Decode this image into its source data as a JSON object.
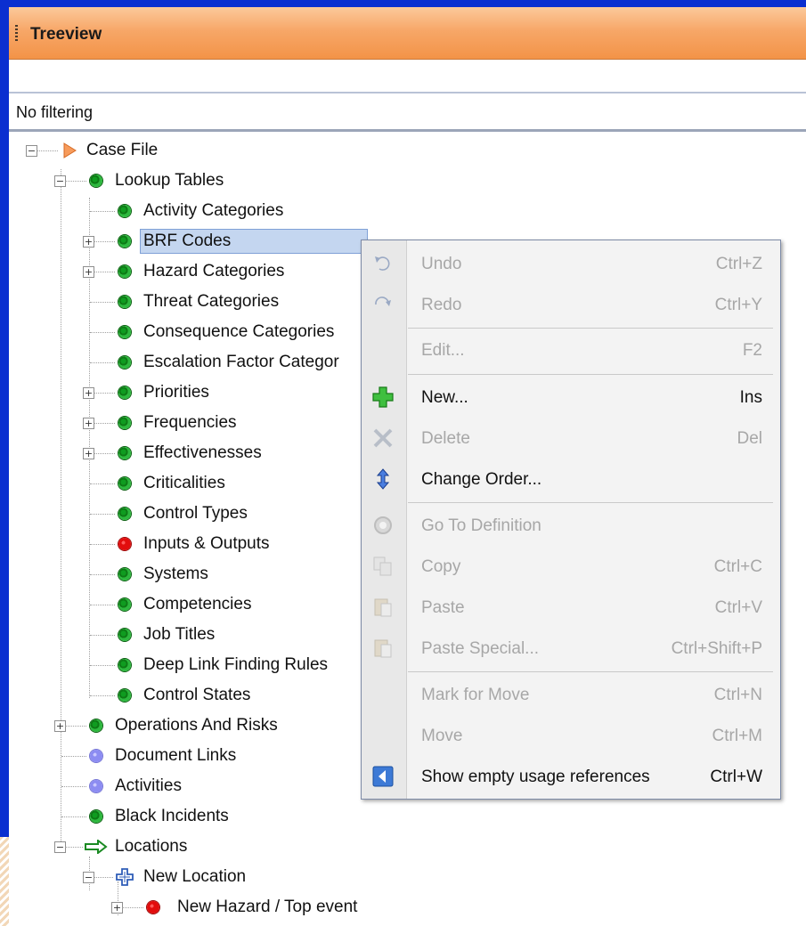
{
  "window": {
    "title": "Treeview"
  },
  "filter": {
    "label": "No filtering"
  },
  "tree": {
    "case_file": "Case File",
    "lookup_tables": "Lookup Tables",
    "items": [
      "Activity Categories",
      "BRF Codes",
      "Hazard Categories",
      "Threat Categories",
      "Consequence Categories",
      "Escalation Factor Categor",
      "Priorities",
      "Frequencies",
      "Effectivenesses",
      "Criticalities",
      "Control Types",
      "Inputs & Outputs",
      "Systems",
      "Competencies",
      "Job Titles",
      "Deep Link Finding Rules",
      "Control States"
    ],
    "operations": "Operations And Risks",
    "document_links": "Document Links",
    "activities": "Activities",
    "black_incidents": "Black Incidents",
    "locations": "Locations",
    "new_location": "New Location",
    "new_hazard": "New Hazard / Top event"
  },
  "menu": {
    "undo": {
      "label": "Undo",
      "shortcut": "Ctrl+Z"
    },
    "redo": {
      "label": "Redo",
      "shortcut": "Ctrl+Y"
    },
    "edit": {
      "label": "Edit...",
      "shortcut": "F2"
    },
    "new": {
      "label": "New...",
      "shortcut": "Ins"
    },
    "delete": {
      "label": "Delete",
      "shortcut": "Del"
    },
    "change_order": {
      "label": "Change Order...",
      "shortcut": ""
    },
    "goto": {
      "label": "Go To Definition",
      "shortcut": ""
    },
    "copy": {
      "label": "Copy",
      "shortcut": "Ctrl+C"
    },
    "paste": {
      "label": "Paste",
      "shortcut": "Ctrl+V"
    },
    "paste_special": {
      "label": "Paste Special...",
      "shortcut": "Ctrl+Shift+P"
    },
    "mark_move": {
      "label": "Mark for Move",
      "shortcut": "Ctrl+N"
    },
    "move": {
      "label": "Move",
      "shortcut": "Ctrl+M"
    },
    "show_empty": {
      "label": "Show empty usage references",
      "shortcut": "Ctrl+W"
    }
  },
  "colors": {
    "frame": "#0b2fd0",
    "titlebar": "#f7a768",
    "selection": "#c4d6f0",
    "status_green": "#0d7a15",
    "status_red": "#e20d0d",
    "status_lavender": "#8c8cf2"
  }
}
